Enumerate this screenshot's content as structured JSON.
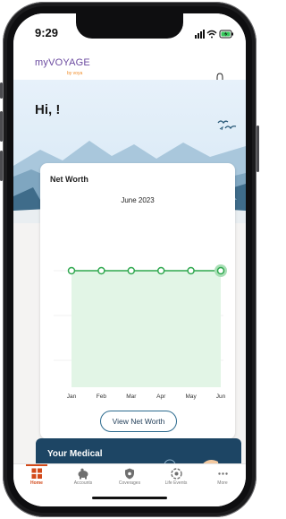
{
  "status_bar": {
    "time": "9:29"
  },
  "app_bar": {
    "logo_main": "myVOYAGE",
    "logo_sub": "by voya"
  },
  "hero": {
    "greeting": "Hi, !"
  },
  "net_worth": {
    "title": "Net Worth",
    "period": "June 2023",
    "button_label": "View Net Worth"
  },
  "chart_data": {
    "type": "line",
    "categories": [
      "Jan",
      "Feb",
      "Mar",
      "Apr",
      "May",
      "Jun"
    ],
    "series": [
      {
        "values": [
          0,
          0,
          0,
          0,
          0,
          0
        ]
      }
    ],
    "ylim": [
      -1,
      1
    ],
    "grid": true,
    "highlight_index": 5,
    "colors": {
      "line": "#2fa84f",
      "fill": "#e2f5e6"
    }
  },
  "medical_card": {
    "title": "Your Medical"
  },
  "tabs": [
    {
      "label": "Home",
      "icon": "home-icon",
      "active": true
    },
    {
      "label": "Accounts",
      "icon": "piggy-bank-icon",
      "active": false
    },
    {
      "label": "Coverages",
      "icon": "shield-icon",
      "active": false
    },
    {
      "label": "Life Events",
      "icon": "life-events-icon",
      "active": false
    },
    {
      "label": "More",
      "icon": "more-icon",
      "active": false
    }
  ],
  "colors": {
    "accent": "#d34a1a",
    "brand_purple": "#6b4aa0",
    "brand_orange": "#f08a24",
    "navy": "#1d4564"
  }
}
